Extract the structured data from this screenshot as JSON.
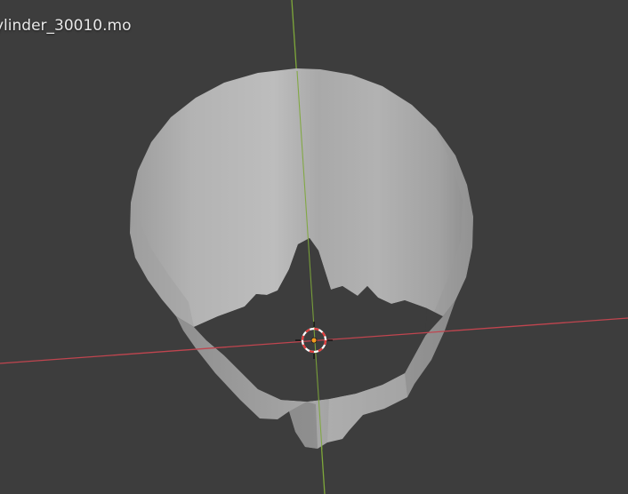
{
  "viewport": {
    "object_name": "ylinder_30010.mo"
  },
  "colors": {
    "background": "#3d3d3d",
    "x_axis": "#c0454f",
    "y_axis": "#7ea83a",
    "mesh_light": "#b9b9b9",
    "mesh_mid": "#a3a3a3",
    "mesh_dark": "#868686",
    "cursor_red": "#e23a3a",
    "origin_dot": "#f39a1f"
  },
  "icons": [
    "3d-cursor-icon",
    "object-origin-icon"
  ]
}
